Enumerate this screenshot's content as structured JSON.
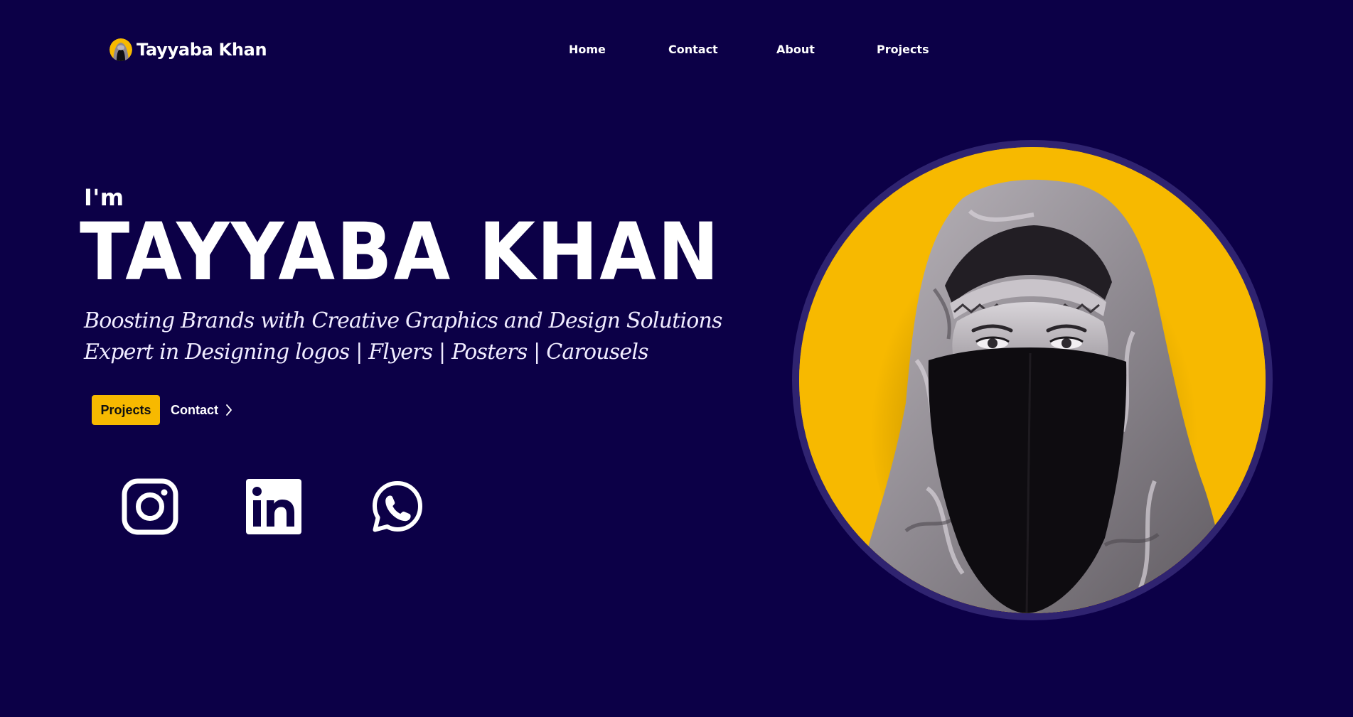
{
  "header": {
    "brand_name": "Tayyaba Khan",
    "brand_avatar_icon": "profile-avatar"
  },
  "nav": {
    "items": [
      {
        "label": "Home"
      },
      {
        "label": "Contact"
      },
      {
        "label": "About"
      },
      {
        "label": "Projects"
      }
    ]
  },
  "hero": {
    "intro": "I'm",
    "name": "TAYYABA KHAN",
    "tagline_line1": "Boosting Brands with Creative Graphics and Design Solutions",
    "tagline_line2": "Expert in Designing logos | Flyers | Posters | Carousels",
    "primary_button": "Projects",
    "secondary_button": "Contact",
    "secondary_button_icon": "chevron-right-icon"
  },
  "social": [
    {
      "name": "instagram",
      "icon": "instagram-icon"
    },
    {
      "name": "linkedin",
      "icon": "linkedin-icon"
    },
    {
      "name": "whatsapp",
      "icon": "whatsapp-icon"
    }
  ],
  "portrait": {
    "subject": "profile photo"
  },
  "colors": {
    "background": "#0c0047",
    "accent": "#f7b900",
    "ring": "#2f2370",
    "text": "#ffffff"
  }
}
